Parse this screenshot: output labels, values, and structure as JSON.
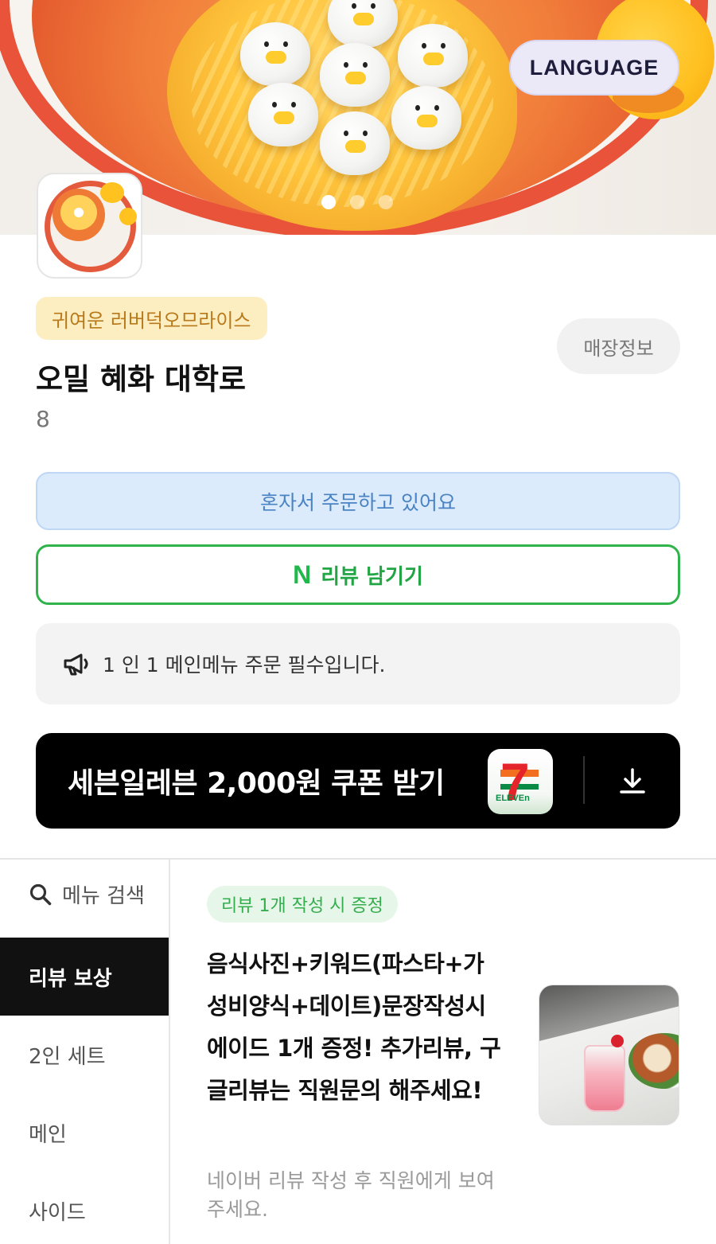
{
  "hero": {
    "language_button": "LANGUAGE",
    "carousel_total": 3,
    "carousel_active": 1
  },
  "store": {
    "tag": "귀여운 러버덕오므라이스",
    "name": "오밀 혜화 대학로",
    "table_number": "8",
    "info_button": "매장정보"
  },
  "actions": {
    "order_mode": "혼자서 주문하고 있어요",
    "review_button": "리뷰 남기기",
    "review_icon_text": "N"
  },
  "notice": {
    "text": "1 인 1 메인메뉴 주문 필수입니다."
  },
  "coupon": {
    "text": "세븐일레븐 2,000원 쿠폰 받기",
    "logo_text": "7",
    "logo_subtext": "ELEVEn"
  },
  "sidebar": {
    "search_label": "메뉴 검색",
    "items": [
      {
        "label": "리뷰 보상",
        "active": true
      },
      {
        "label": "2인 세트",
        "active": false
      },
      {
        "label": "메인",
        "active": false
      },
      {
        "label": "사이드",
        "active": false
      }
    ]
  },
  "menu_item": {
    "badge": "리뷰 1개 작성 시 증정",
    "title": "음식사진+키워드(파스타+가성비양식+데이트)문장작성시 에이드 1개 증정! 추가리뷰, 구글리뷰는 직원문의 해주세요!",
    "description": "네이버 리뷰 작성 후 직원에게 보여주세요."
  },
  "colors": {
    "accent_green": "#2fb34a",
    "order_mode_bg": "#dcebfb",
    "tag_bg": "#fdeec2",
    "active_sidebar_bg": "#111111",
    "coupon_bg": "#000000"
  }
}
